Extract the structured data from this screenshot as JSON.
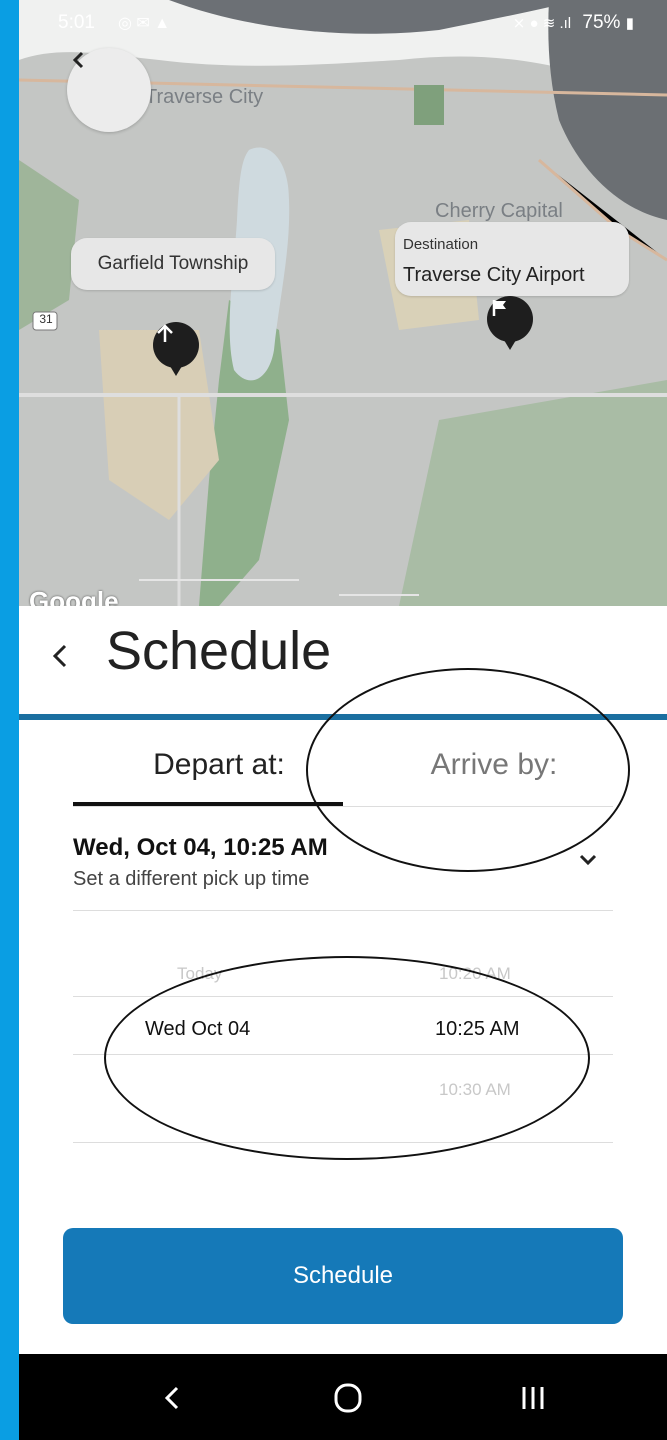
{
  "status_bar": {
    "time": "5:01",
    "notification_icons": [
      "@",
      "✉",
      "▲"
    ],
    "right": "75%"
  },
  "map": {
    "place_labels": {
      "city": "Traverse City",
      "cherry": "Cherry Capital"
    },
    "origin": {
      "label": "Garfield Township"
    },
    "destination": {
      "caption": "Destination",
      "name": "Traverse City Airport"
    },
    "route_shield": "31",
    "attribution": "Google"
  },
  "sheet": {
    "back_icon": "chevron-left-icon",
    "title": "Schedule",
    "tabs": [
      {
        "label": "Depart at:",
        "selected": true
      },
      {
        "label": "Arrive by:",
        "selected": false
      }
    ],
    "selected_datetime": "Wed, Oct 04, 10:25 AM",
    "selected_sub": "Set a different pick up time",
    "picker": {
      "day_prev": "Today",
      "day_current": "Wed Oct 04",
      "time_prev": "10:20 AM",
      "time_current": "10:25 AM",
      "time_next": "10:30 AM"
    },
    "button_label": "Schedule"
  },
  "colors": {
    "accent": "#1579b8",
    "frame": "#0a9ee3",
    "nav_bg": "#000000"
  }
}
